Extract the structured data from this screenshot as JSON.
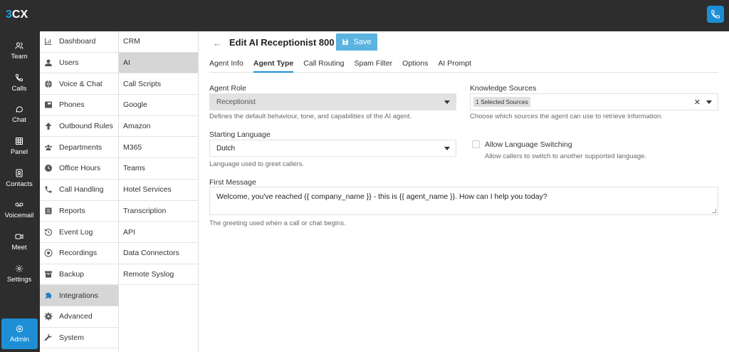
{
  "app": {
    "logo_prefix": "3",
    "logo_suffix": "CX"
  },
  "leftbar": {
    "items": [
      {
        "label": "Team",
        "icon": "team-icon"
      },
      {
        "label": "Calls",
        "icon": "phone-icon"
      },
      {
        "label": "Chat",
        "icon": "chat-icon"
      },
      {
        "label": "Panel",
        "icon": "grid-icon"
      },
      {
        "label": "Contacts",
        "icon": "contacts-icon"
      },
      {
        "label": "Voicemail",
        "icon": "voicemail-icon"
      },
      {
        "label": "Meet",
        "icon": "video-icon"
      },
      {
        "label": "Settings",
        "icon": "gear-icon"
      }
    ],
    "admin_label": "Admin"
  },
  "menu1": {
    "items": [
      {
        "label": "Dashboard"
      },
      {
        "label": "Users"
      },
      {
        "label": "Voice & Chat"
      },
      {
        "label": "Phones"
      },
      {
        "label": "Outbound Rules"
      },
      {
        "label": "Departments"
      },
      {
        "label": "Office Hours"
      },
      {
        "label": "Call Handling"
      },
      {
        "label": "Reports"
      },
      {
        "label": "Event Log"
      },
      {
        "label": "Recordings"
      },
      {
        "label": "Backup"
      },
      {
        "label": "Integrations"
      },
      {
        "label": "Advanced"
      },
      {
        "label": "System"
      }
    ],
    "active": "Integrations"
  },
  "menu2": {
    "items": [
      {
        "label": "CRM"
      },
      {
        "label": "AI"
      },
      {
        "label": "Call Scripts"
      },
      {
        "label": "Google"
      },
      {
        "label": "Amazon"
      },
      {
        "label": "M365"
      },
      {
        "label": "Teams"
      },
      {
        "label": "Hotel Services"
      },
      {
        "label": "Transcription"
      },
      {
        "label": "API"
      },
      {
        "label": "Data Connectors"
      },
      {
        "label": "Remote Syslog"
      }
    ],
    "active": "AI"
  },
  "header": {
    "title": "Edit AI Receptionist 800",
    "save_label": "Save"
  },
  "tabs": [
    {
      "label": "Agent Info"
    },
    {
      "label": "Agent Type"
    },
    {
      "label": "Call Routing"
    },
    {
      "label": "Spam Filter"
    },
    {
      "label": "Options"
    },
    {
      "label": "AI Prompt"
    }
  ],
  "active_tab": "Agent Type",
  "form": {
    "agent_role": {
      "label": "Agent Role",
      "value": "Receptionist",
      "help": "Defines the default behaviour, tone, and capabilities of the AI agent."
    },
    "knowledge_sources": {
      "label": "Knowledge Sources",
      "value": "1 Selected Sources",
      "help": "Choose which sources the agent can use to retrieve information."
    },
    "starting_language": {
      "label": "Starting Language",
      "value": "Dutch",
      "help": "Language used to greet callers."
    },
    "allow_language_switching": {
      "label": "Allow Language Switching",
      "help": "Allow callers to switch to another supported language.",
      "checked": false
    },
    "first_message": {
      "label": "First Message",
      "value": "Welcome, you've reached {{ company_name }} - this is {{ agent_name }}. How can I help you today?",
      "help": "The greeting used when a call or chat begins."
    }
  },
  "colors": {
    "accent": "#1e8fd6",
    "save_button": "#5bb3e0",
    "dark_bar": "#2d2d2d"
  }
}
